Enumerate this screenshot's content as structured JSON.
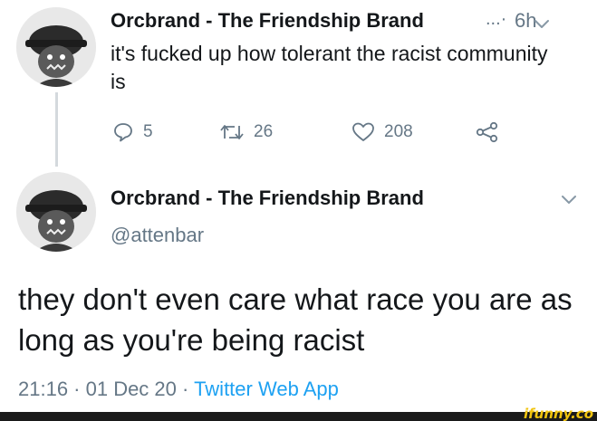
{
  "tweet1": {
    "display_name": "Orcbrand - The Friendship Brand",
    "ellipsis": "...·",
    "time": "6h",
    "text": "it's fucked up how tolerant the racist community is",
    "reply_count": "5",
    "retweet_count": "26",
    "like_count": "208"
  },
  "tweet2": {
    "display_name": "Orcbrand - The Friendship Brand",
    "handle": "@attenbar",
    "text": "they don't even care what race you are as long as you're being racist",
    "timestamp": "21:16 · 01 Dec 20 ·",
    "source": "Twitter Web App"
  },
  "watermark": "ifunny.co",
  "icons": {
    "reply": "speech-bubble-icon",
    "retweet": "retweet-arrows-icon",
    "like": "heart-icon",
    "share": "share-icon",
    "more": "chevron-down-icon"
  },
  "colors": {
    "text": "#14171a",
    "muted": "#657786",
    "link": "#1da1f2",
    "watermark": "#f1c40f"
  }
}
